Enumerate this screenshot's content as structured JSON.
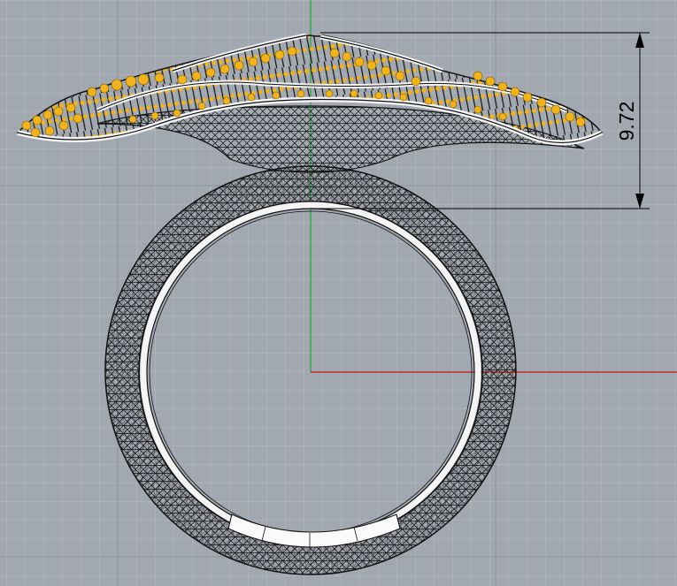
{
  "viewport": {
    "background": "#a2a8b0",
    "grid_minor_color": "#b8bdc4",
    "grid_major_color": "#8d939b",
    "x_axis_color": "#c0292b",
    "y_axis_color": "#2fa84a"
  },
  "model": {
    "wire_color": "#111111",
    "gem_color": "#f2b21a",
    "metal_color": "#f4f4f4"
  },
  "dimension": {
    "value": "9.72",
    "line_color": "#000000"
  }
}
